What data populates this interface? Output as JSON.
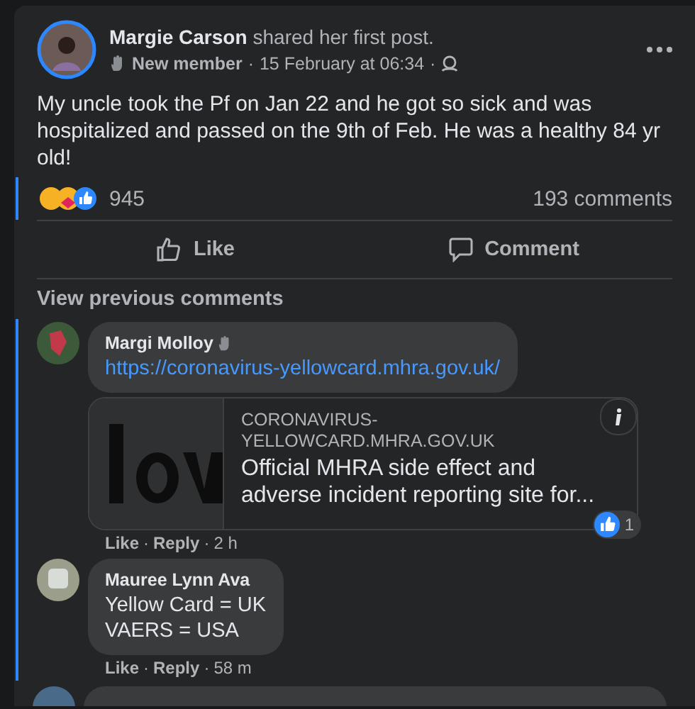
{
  "separator": "·",
  "post": {
    "author": "Margie Carson",
    "action": "shared her first post.",
    "badge": "New member",
    "time": "15 February at 06:34",
    "text": "My uncle took the Pf on Jan 22 and he got so sick and was hospitalized and passed on the 9th of Feb. He was a healthy 84 yr old!",
    "reaction_count": "945",
    "comment_count": "193 comments"
  },
  "actions": [
    {
      "kind": "like",
      "label": "Like"
    },
    {
      "kind": "comment",
      "label": "Comment"
    }
  ],
  "view_previous": "View previous comments",
  "comments": [
    {
      "author": "Margi Molloy",
      "lines": [
        "https://coronavirus-yellowcard.mhra.gov.uk/"
      ],
      "kind": "link",
      "preview": {
        "domain": "CORONAVIRUS-YELLOWCARD.MHRA.GOV.UK",
        "title": "Official MHRA side effect and adverse incident reporting site for..."
      },
      "likes": "1",
      "footer": [
        "Like",
        "Reply",
        "2 h"
      ]
    },
    {
      "author": "Mauree Lynn Ava",
      "lines": [
        "Yellow Card = UK",
        "VAERS = USA"
      ],
      "kind": "text",
      "footer": [
        "Like",
        "Reply",
        "58 m"
      ]
    }
  ]
}
